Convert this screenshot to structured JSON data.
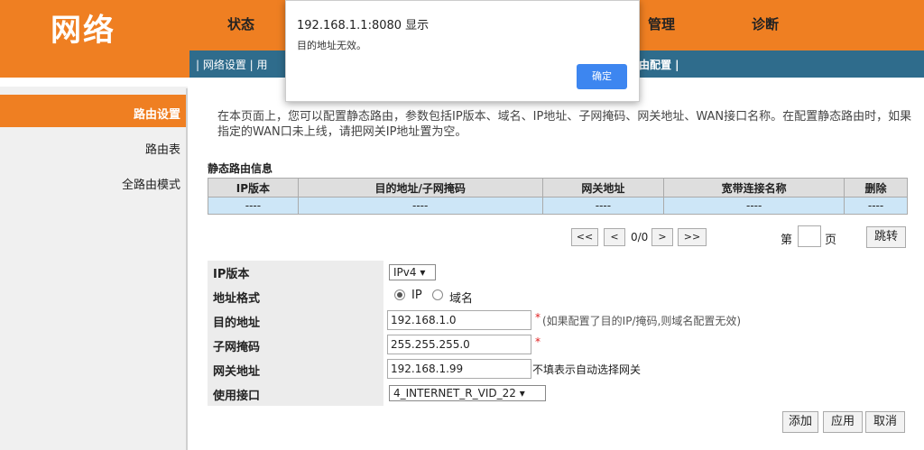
{
  "header": {
    "logo": "网络",
    "menu": [
      "状态",
      "管理",
      "诊断"
    ]
  },
  "subnav": {
    "items_left": "| 网络设置 | 用",
    "items_right": "由配置 |"
  },
  "sidebar": {
    "items": [
      {
        "label": "路由设置",
        "active": true
      },
      {
        "label": "路由表",
        "active": false
      },
      {
        "label": "全路由模式",
        "active": false
      }
    ]
  },
  "intro": "在本页面上，您可以配置静态路由，参数包括IP版本、域名、IP地址、子网掩码、网关地址、WAN接口名称。在配置静态路由时，如果指定的WAN口未上线，请把网关IP地址置为空。",
  "route_table": {
    "title": "静态路由信息",
    "columns": [
      "IP版本",
      "目的地址/子网掩码",
      "网关地址",
      "宽带连接名称",
      "删除"
    ],
    "rows": [
      [
        "----",
        "----",
        "----",
        "----",
        "----"
      ]
    ]
  },
  "pagination": {
    "first": "<<",
    "prev": "<",
    "count": "0/0",
    "next": ">",
    "last": ">>",
    "page_prefix": "第",
    "page_suffix": "页",
    "jump": "跳转"
  },
  "form": {
    "ip_version": {
      "label": "IP版本",
      "value": "IPv4 ▾"
    },
    "address_format": {
      "label": "地址格式",
      "option_ip": "IP",
      "option_domain": "域名",
      "selected": "IP"
    },
    "destination": {
      "label": "目的地址",
      "value": "192.168.1.0",
      "required": "*",
      "hint": "(如果配置了目的IP/掩码,则域名配置无效)"
    },
    "subnet_mask": {
      "label": "子网掩码",
      "value": "255.255.255.0",
      "required": "*"
    },
    "gateway": {
      "label": "网关地址",
      "value": "192.168.1.99",
      "hint": "不填表示自动选择网关"
    },
    "interface": {
      "label": "使用接口",
      "value": "4_INTERNET_R_VID_22 ▾"
    }
  },
  "actions": {
    "add": "添加",
    "apply": "应用",
    "cancel": "取消"
  },
  "dialog": {
    "title": "192.168.1.1:8080 显示",
    "message": "目的地址无效。",
    "ok": "确定"
  },
  "colors": {
    "brand_orange": "#ef7f22",
    "subnav_blue": "#2f6c8c",
    "dialog_button": "#3d86f0"
  }
}
